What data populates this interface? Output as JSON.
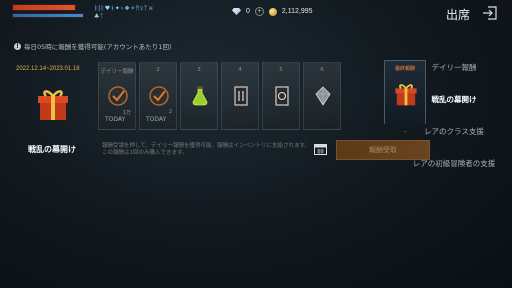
{
  "hud": {
    "buff_row1": "ᛒ|ᚱ♥ᚼ✦ᛃ❖✧ᛗᛟᛉ⚔",
    "buff_row2": "♣ᛏ"
  },
  "currency": {
    "gems": "0",
    "gold": "2,112,995"
  },
  "header": {
    "title": "出席"
  },
  "notice": "毎日05時に報酬を獲得可能(アカウントあたり1回)",
  "event": {
    "date_range": "2022.12.14~2023.01.18",
    "name": "戦乱の幕開け"
  },
  "slots": [
    {
      "label": "デイリー報酬",
      "today": "TODAY",
      "sub": "1万"
    },
    {
      "label": "2",
      "today": "TODAY",
      "sub": "2"
    },
    {
      "label": "3",
      "today": "",
      "sub": ""
    },
    {
      "label": "4",
      "today": "",
      "sub": ""
    },
    {
      "label": "5",
      "today": "",
      "sub": ""
    },
    {
      "label": "6",
      "today": "",
      "sub": ""
    }
  ],
  "final_reward": {
    "label": "最終報酬"
  },
  "description": "報酬受領を押して、デイリー報酬を獲得可能。報酬はインベントリに支給されます。この報酬は1回のみ購入できます。",
  "claim_button": "報酬受取",
  "menu": [
    {
      "label": "デイリー報酬",
      "active": false
    },
    {
      "label": "戦乱の幕開け",
      "active": true
    },
    {
      "label": "レアのクラス支援",
      "active": false
    },
    {
      "label": "レアの初級冒険者の支援",
      "active": false
    }
  ]
}
